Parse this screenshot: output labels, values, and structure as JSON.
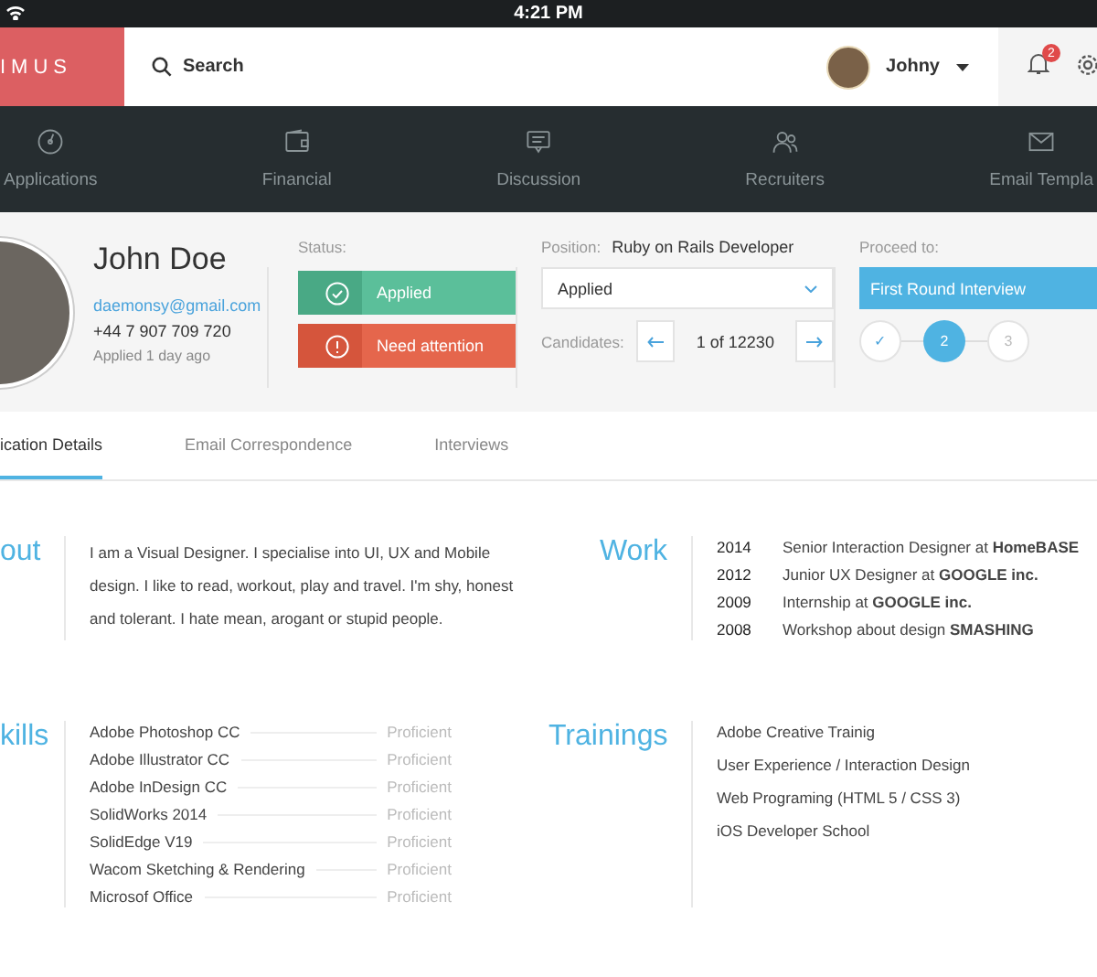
{
  "status_bar": {
    "time": "4:21 PM"
  },
  "header": {
    "logo": "IMUS",
    "search": "Search",
    "user": "Johny",
    "notifications": "2"
  },
  "nav": [
    {
      "label": "Applications",
      "kind": "gauge"
    },
    {
      "label": "Financial",
      "kind": "wallet"
    },
    {
      "label": "Discussion",
      "kind": "chat"
    },
    {
      "label": "Recruiters",
      "kind": "people"
    },
    {
      "label": "Email Templa",
      "kind": "mail"
    }
  ],
  "profile": {
    "name": "John Doe",
    "email": "daemonsy@gmail.com",
    "phone": "+44 7 907 709 720",
    "applied": "Applied 1 day ago",
    "status_label": "Status:",
    "statuses": [
      {
        "label": "Applied",
        "kind": "ok"
      },
      {
        "label": "Need attention",
        "kind": "warn"
      }
    ],
    "position_label": "Position:",
    "position": "Ruby on Rails Developer",
    "stage_value": "Applied",
    "candidates_label": "Candidates:",
    "candidates": "1 of 12230",
    "proceed_label": "Proceed to:",
    "proceed_button": "First Round Interview",
    "steps": [
      {
        "label": "✓",
        "kind": "done"
      },
      {
        "label": "2",
        "kind": "current"
      },
      {
        "label": "3",
        "kind": "pending"
      }
    ]
  },
  "tabs": [
    {
      "label": "ication Details",
      "selected": true
    },
    {
      "label": "Email Correspondence",
      "selected": false
    },
    {
      "label": "Interviews",
      "selected": false
    }
  ],
  "about": {
    "heading": "out",
    "text": "I am a Visual Designer. I specialise into UI, UX and Mobile design. I like to read, workout, play and travel. I'm shy, honest and tolerant. I hate mean, arogant or stupid people."
  },
  "work": {
    "heading": "Work",
    "items": [
      {
        "year": "2014",
        "text": "Senior Interaction Designer at **HomeBASE**"
      },
      {
        "year": "2012",
        "text": "Junior UX Designer at **GOOGLE inc.**"
      },
      {
        "year": "2009",
        "text": "Internship at **GOOGLE inc.**"
      },
      {
        "year": "2008",
        "text": "Workshop about design **SMASHING**"
      }
    ]
  },
  "skills": {
    "heading": "kills",
    "items": [
      {
        "name": "Adobe Photoshop CC",
        "level": "Proficient"
      },
      {
        "name": "Adobe Illustrator CC",
        "level": "Proficient"
      },
      {
        "name": "Adobe InDesign CC",
        "level": "Proficient"
      },
      {
        "name": "SolidWorks 2014",
        "level": "Proficient"
      },
      {
        "name": "SolidEdge V19",
        "level": "Proficient"
      },
      {
        "name": "Wacom Sketching & Rendering",
        "level": "Proficient"
      },
      {
        "name": "Microsof Office",
        "level": "Proficient"
      }
    ]
  },
  "trainings": {
    "heading": "Trainings",
    "items": [
      "Adobe Creative Trainig",
      "User Experience / Interaction Design",
      "Web Programing (HTML 5 / CSS 3)",
      "iOS Developer School"
    ]
  }
}
